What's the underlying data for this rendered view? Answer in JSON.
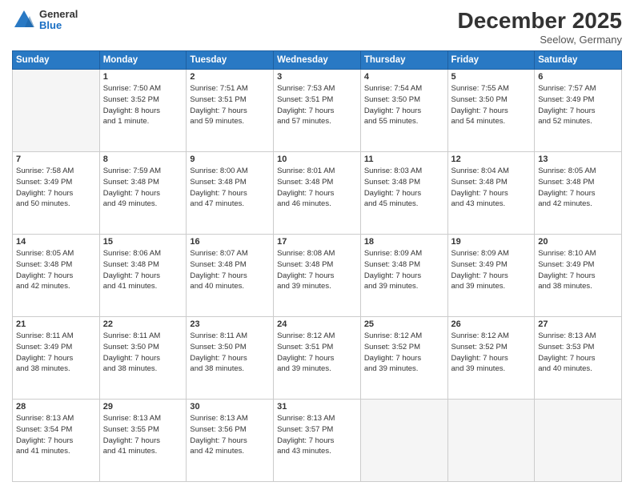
{
  "header": {
    "logo": {
      "general": "General",
      "blue": "Blue"
    },
    "title": "December 2025",
    "subtitle": "Seelow, Germany"
  },
  "calendar": {
    "headers": [
      "Sunday",
      "Monday",
      "Tuesday",
      "Wednesday",
      "Thursday",
      "Friday",
      "Saturday"
    ],
    "weeks": [
      [
        {
          "day": "",
          "info": ""
        },
        {
          "day": "1",
          "info": "Sunrise: 7:50 AM\nSunset: 3:52 PM\nDaylight: 8 hours\nand 1 minute."
        },
        {
          "day": "2",
          "info": "Sunrise: 7:51 AM\nSunset: 3:51 PM\nDaylight: 7 hours\nand 59 minutes."
        },
        {
          "day": "3",
          "info": "Sunrise: 7:53 AM\nSunset: 3:51 PM\nDaylight: 7 hours\nand 57 minutes."
        },
        {
          "day": "4",
          "info": "Sunrise: 7:54 AM\nSunset: 3:50 PM\nDaylight: 7 hours\nand 55 minutes."
        },
        {
          "day": "5",
          "info": "Sunrise: 7:55 AM\nSunset: 3:50 PM\nDaylight: 7 hours\nand 54 minutes."
        },
        {
          "day": "6",
          "info": "Sunrise: 7:57 AM\nSunset: 3:49 PM\nDaylight: 7 hours\nand 52 minutes."
        }
      ],
      [
        {
          "day": "7",
          "info": "Sunrise: 7:58 AM\nSunset: 3:49 PM\nDaylight: 7 hours\nand 50 minutes."
        },
        {
          "day": "8",
          "info": "Sunrise: 7:59 AM\nSunset: 3:48 PM\nDaylight: 7 hours\nand 49 minutes."
        },
        {
          "day": "9",
          "info": "Sunrise: 8:00 AM\nSunset: 3:48 PM\nDaylight: 7 hours\nand 47 minutes."
        },
        {
          "day": "10",
          "info": "Sunrise: 8:01 AM\nSunset: 3:48 PM\nDaylight: 7 hours\nand 46 minutes."
        },
        {
          "day": "11",
          "info": "Sunrise: 8:03 AM\nSunset: 3:48 PM\nDaylight: 7 hours\nand 45 minutes."
        },
        {
          "day": "12",
          "info": "Sunrise: 8:04 AM\nSunset: 3:48 PM\nDaylight: 7 hours\nand 43 minutes."
        },
        {
          "day": "13",
          "info": "Sunrise: 8:05 AM\nSunset: 3:48 PM\nDaylight: 7 hours\nand 42 minutes."
        }
      ],
      [
        {
          "day": "14",
          "info": "Sunrise: 8:05 AM\nSunset: 3:48 PM\nDaylight: 7 hours\nand 42 minutes."
        },
        {
          "day": "15",
          "info": "Sunrise: 8:06 AM\nSunset: 3:48 PM\nDaylight: 7 hours\nand 41 minutes."
        },
        {
          "day": "16",
          "info": "Sunrise: 8:07 AM\nSunset: 3:48 PM\nDaylight: 7 hours\nand 40 minutes."
        },
        {
          "day": "17",
          "info": "Sunrise: 8:08 AM\nSunset: 3:48 PM\nDaylight: 7 hours\nand 39 minutes."
        },
        {
          "day": "18",
          "info": "Sunrise: 8:09 AM\nSunset: 3:48 PM\nDaylight: 7 hours\nand 39 minutes."
        },
        {
          "day": "19",
          "info": "Sunrise: 8:09 AM\nSunset: 3:49 PM\nDaylight: 7 hours\nand 39 minutes."
        },
        {
          "day": "20",
          "info": "Sunrise: 8:10 AM\nSunset: 3:49 PM\nDaylight: 7 hours\nand 38 minutes."
        }
      ],
      [
        {
          "day": "21",
          "info": "Sunrise: 8:11 AM\nSunset: 3:49 PM\nDaylight: 7 hours\nand 38 minutes."
        },
        {
          "day": "22",
          "info": "Sunrise: 8:11 AM\nSunset: 3:50 PM\nDaylight: 7 hours\nand 38 minutes."
        },
        {
          "day": "23",
          "info": "Sunrise: 8:11 AM\nSunset: 3:50 PM\nDaylight: 7 hours\nand 38 minutes."
        },
        {
          "day": "24",
          "info": "Sunrise: 8:12 AM\nSunset: 3:51 PM\nDaylight: 7 hours\nand 39 minutes."
        },
        {
          "day": "25",
          "info": "Sunrise: 8:12 AM\nSunset: 3:52 PM\nDaylight: 7 hours\nand 39 minutes."
        },
        {
          "day": "26",
          "info": "Sunrise: 8:12 AM\nSunset: 3:52 PM\nDaylight: 7 hours\nand 39 minutes."
        },
        {
          "day": "27",
          "info": "Sunrise: 8:13 AM\nSunset: 3:53 PM\nDaylight: 7 hours\nand 40 minutes."
        }
      ],
      [
        {
          "day": "28",
          "info": "Sunrise: 8:13 AM\nSunset: 3:54 PM\nDaylight: 7 hours\nand 41 minutes."
        },
        {
          "day": "29",
          "info": "Sunrise: 8:13 AM\nSunset: 3:55 PM\nDaylight: 7 hours\nand 41 minutes."
        },
        {
          "day": "30",
          "info": "Sunrise: 8:13 AM\nSunset: 3:56 PM\nDaylight: 7 hours\nand 42 minutes."
        },
        {
          "day": "31",
          "info": "Sunrise: 8:13 AM\nSunset: 3:57 PM\nDaylight: 7 hours\nand 43 minutes."
        },
        {
          "day": "",
          "info": ""
        },
        {
          "day": "",
          "info": ""
        },
        {
          "day": "",
          "info": ""
        }
      ]
    ]
  }
}
